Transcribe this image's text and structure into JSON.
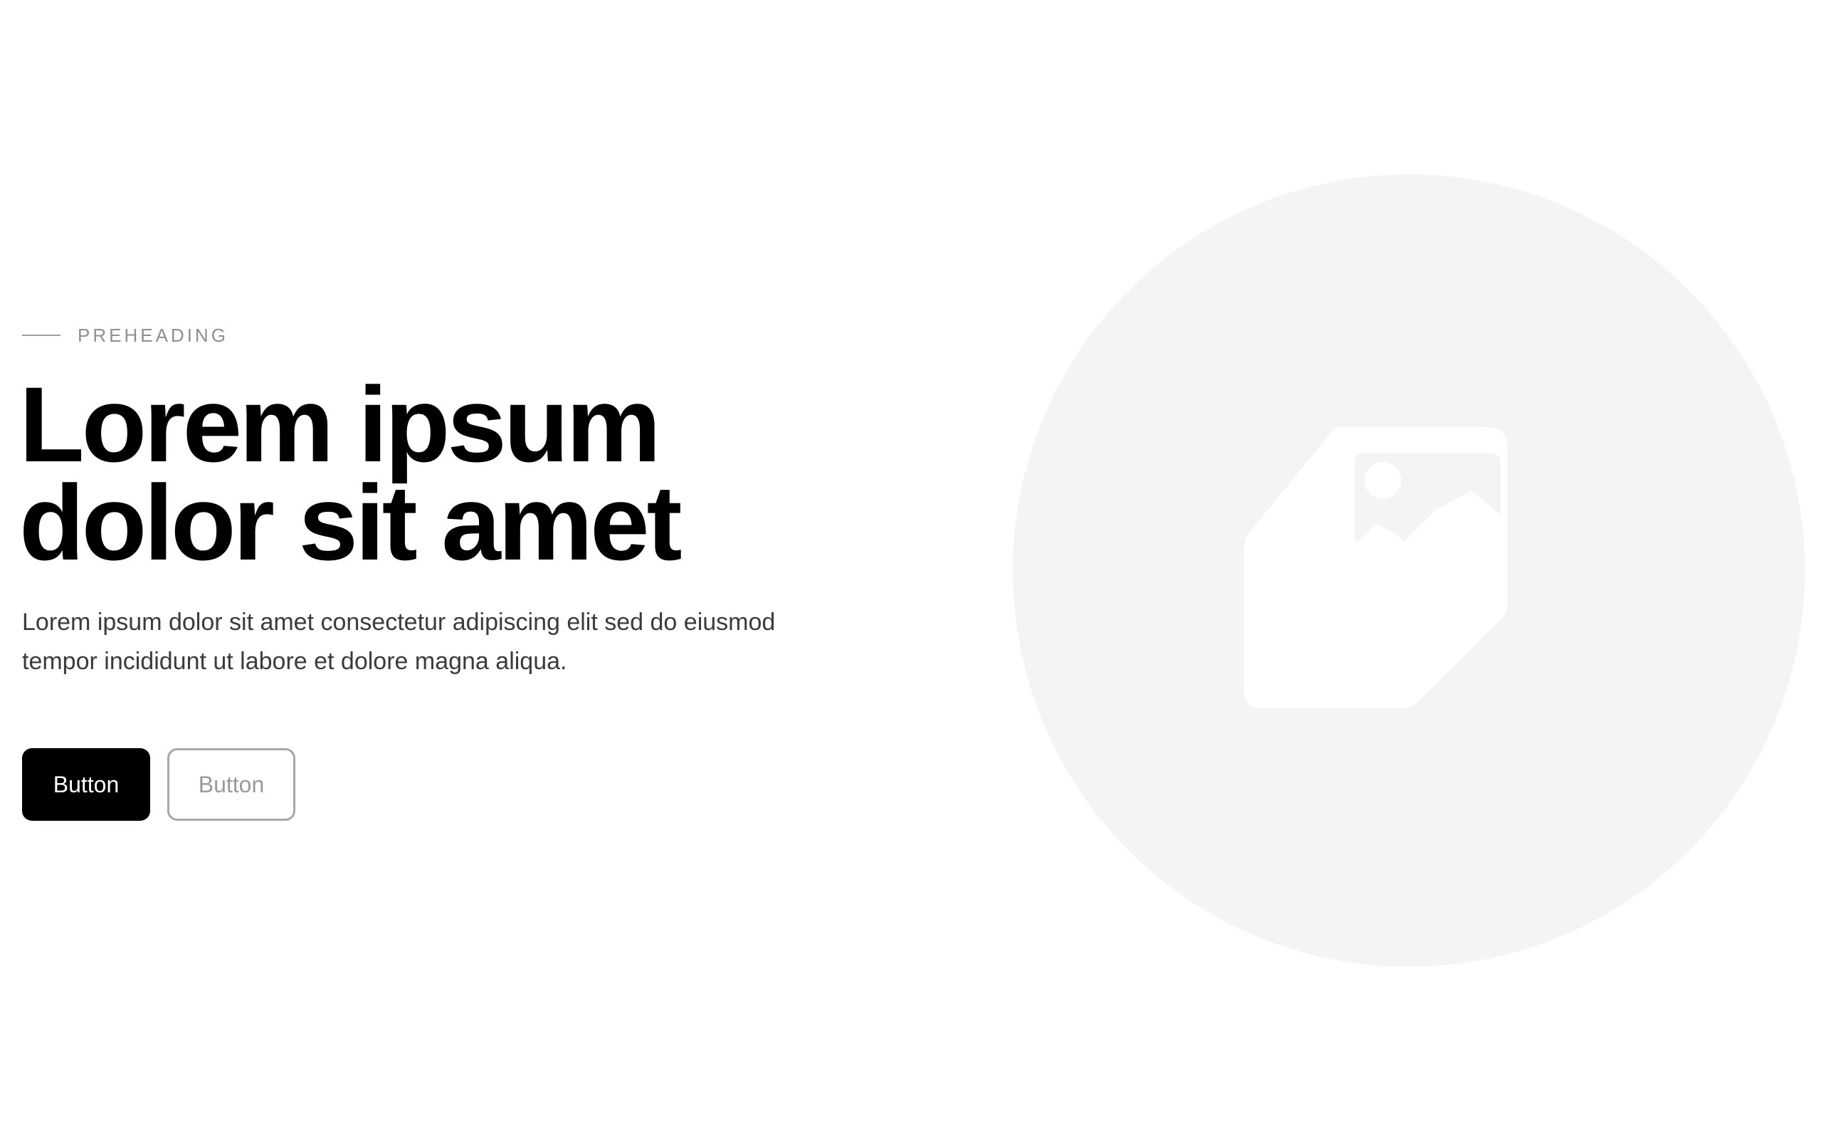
{
  "hero": {
    "preheading": "PREHEADING",
    "title_line1": "Lorem ipsum",
    "title_line2": "dolor sit amet",
    "description": "Lorem ipsum dolor sit amet consectetur adipiscing elit sed do eiusmod tempor incididunt ut labore et dolore magna aliqua.",
    "primary_button": "Button",
    "secondary_button": "Button"
  },
  "media": {
    "icon": "image-placeholder-icon"
  },
  "colors": {
    "background": "#ffffff",
    "heading": "#000000",
    "body_text": "#3b3b3b",
    "muted": "#8f8f8f",
    "media_circle": "#f4f4f4",
    "primary_button_bg": "#000000",
    "primary_button_text": "#ffffff"
  }
}
